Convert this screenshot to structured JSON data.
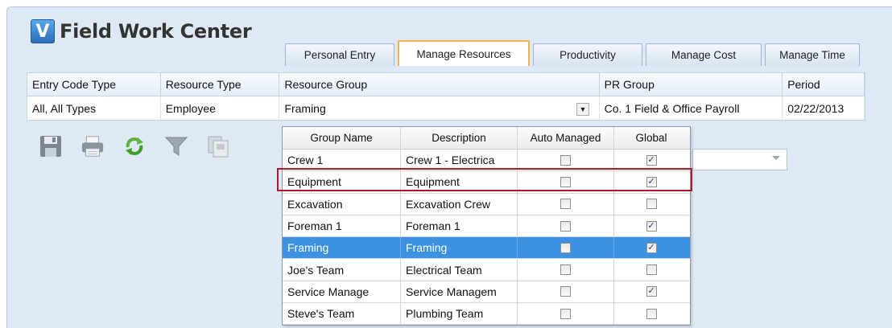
{
  "app": {
    "logo_letter": "V",
    "title": "Field Work Center"
  },
  "tabs": [
    {
      "label": "Personal Entry",
      "active": false
    },
    {
      "label": "Manage Resources",
      "active": true
    },
    {
      "label": "Productivity",
      "active": false
    },
    {
      "label": "Manage Cost",
      "active": false
    },
    {
      "label": "Manage Time",
      "active": false
    }
  ],
  "filters": {
    "headers": {
      "entry_code_type": "Entry Code Type",
      "resource_type": "Resource Type",
      "resource_group": "Resource Group",
      "pr_group": "PR Group",
      "period": "Period"
    },
    "values": {
      "entry_code_type": "All, All Types",
      "resource_type": "Employee",
      "resource_group": "Framing",
      "pr_group": "Co. 1 Field & Office Payroll",
      "period": "02/22/2013"
    }
  },
  "toolbar": {
    "icons": [
      "save-icon",
      "print-icon",
      "refresh-icon",
      "filter-icon",
      "copy-icon"
    ]
  },
  "dropdown": {
    "columns": [
      "Group Name",
      "Description",
      "Auto Managed",
      "Global"
    ],
    "rows": [
      {
        "name": "Crew 1",
        "description": "Crew 1 - Electrica",
        "auto_managed": false,
        "global": true
      },
      {
        "name": "Equipment",
        "description": "Equipment",
        "auto_managed": false,
        "global": true
      },
      {
        "name": "Excavation",
        "description": "Excavation Crew",
        "auto_managed": false,
        "global": false
      },
      {
        "name": "Foreman 1",
        "description": "Foreman 1",
        "auto_managed": false,
        "global": true
      },
      {
        "name": "Framing",
        "description": "Framing",
        "auto_managed": false,
        "global": true
      },
      {
        "name": "Joe's Team",
        "description": "Electrical Team",
        "auto_managed": false,
        "global": false
      },
      {
        "name": "Service Manage",
        "description": "Service Managem",
        "auto_managed": false,
        "global": true
      },
      {
        "name": "Steve's Team",
        "description": "Plumbing Team",
        "auto_managed": false,
        "global": false
      }
    ],
    "selected_row": "Framing",
    "highlighted_row": "Equipment"
  },
  "colors": {
    "selection": "#3c92e0",
    "active_tab_border": "#f3b24b",
    "highlight_box": "#b3172a",
    "window_bg": "#dfe9f5"
  }
}
